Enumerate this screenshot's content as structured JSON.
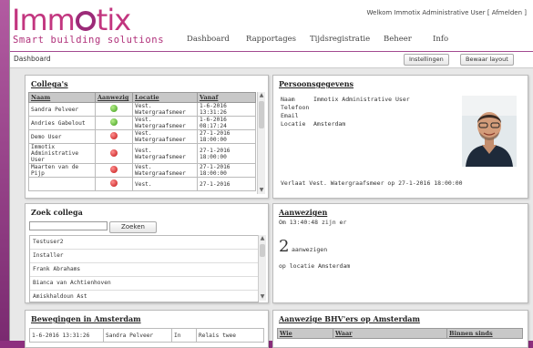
{
  "header": {
    "logo_text": "Imm",
    "logo_text2": "tix",
    "tagline": "Smart building solutions",
    "welcome": "Welkom Immotix Administrative User",
    "logout": "[ Afmelden ]"
  },
  "nav": [
    "Dashboard",
    "Rapportages",
    "Tijdsregistratie",
    "Beheer",
    "Info"
  ],
  "subbar": {
    "breadcrumb": "Dashboard",
    "settings_button": "Instellingen",
    "save_layout_button": "Bewaar layout"
  },
  "collegas": {
    "title": "Collega's",
    "columns": [
      "Naam",
      "Aanwezig",
      "Locatie",
      "Vanaf"
    ],
    "rows": [
      {
        "naam": "Sandra Pelveer",
        "status": "green",
        "locatie": "Vest. Watergraafsmeer",
        "vanaf": "1-6-2016 13:31:26"
      },
      {
        "naam": "Andries Gabelout",
        "status": "green",
        "locatie": "Vest. Watergraafsmeer",
        "vanaf": "1-6-2016 08:17:24"
      },
      {
        "naam": "Demo User",
        "status": "red",
        "locatie": "Vest. Watergraafsmeer",
        "vanaf": "27-1-2016 18:00:00"
      },
      {
        "naam": "Immotix Administrative User",
        "status": "red",
        "locatie": "Vest. Watergraafsmeer",
        "vanaf": "27-1-2016 18:00:00"
      },
      {
        "naam": "Maarten van de Pijp",
        "status": "red",
        "locatie": "Vest. Watergraafsmeer",
        "vanaf": "27-1-2016 18:00:00"
      },
      {
        "naam": "",
        "status": "red",
        "locatie": "Vest.",
        "vanaf": "27-1-2016"
      }
    ]
  },
  "persoon": {
    "title": "Persoonsgegevens",
    "fields": [
      {
        "k": "Naam",
        "v": "Immotix Administrative User"
      },
      {
        "k": "Telefoon",
        "v": ""
      },
      {
        "k": "Email",
        "v": ""
      },
      {
        "k": "Locatie",
        "v": "Amsterdam"
      }
    ],
    "footer": "Verlaat Vest. Watergraafsmeer op 27-1-2016 18:00:00"
  },
  "zoek": {
    "title": "Zoek collega",
    "button": "Zoeken",
    "results": [
      "Testuser2",
      "Installer",
      "Frank Abrahams",
      "Bianca van Achtienhoven",
      "Amiskhaldoun Ast"
    ]
  },
  "aanwezigen": {
    "title": "Aanwezigen",
    "time_line": "Om 13:40:48 zijn er",
    "count": "2",
    "count_label": "aanwezigen",
    "location_line": "op locatie Amsterdam"
  },
  "bewegingen": {
    "title": "Bewegingen in Amsterdam",
    "row": [
      "1-6-2016 13:31:26",
      "Sandra Pelveer",
      "In",
      "Relais twee"
    ]
  },
  "bhv": {
    "title": "Aanwezige BHV'ers op Amsterdam",
    "columns": [
      "Wie",
      "Waar",
      "Binnen sinds"
    ]
  }
}
